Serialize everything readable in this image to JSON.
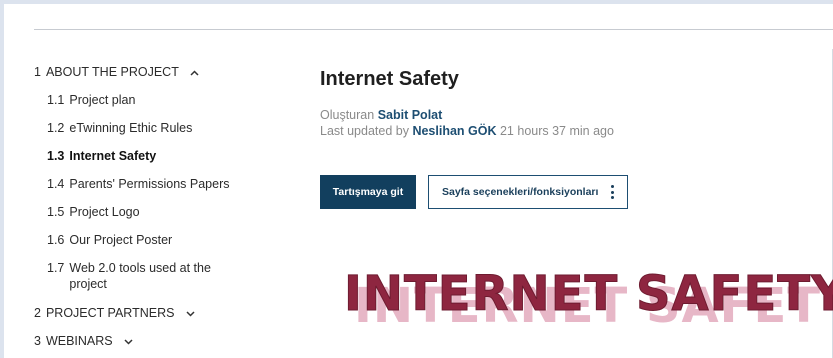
{
  "sidebar": {
    "items": [
      {
        "num": "1",
        "label": "ABOUT THE PROJECT",
        "expanded": true
      },
      {
        "num": "1.1",
        "label": "Project plan"
      },
      {
        "num": "1.2",
        "label": "eTwinning Ethic Rules"
      },
      {
        "num": "1.3",
        "label": "Internet Safety",
        "active": true
      },
      {
        "num": "1.4",
        "label": "Parents' Permissions Papers"
      },
      {
        "num": "1.5",
        "label": "Project Logo"
      },
      {
        "num": "1.6",
        "label": "Our Project Poster"
      },
      {
        "num": "1.7",
        "label": "Web 2.0 tools used at the project"
      },
      {
        "num": "2",
        "label": "PROJECT PARTNERS",
        "expanded": false
      },
      {
        "num": "3",
        "label": "WEBINARS",
        "expanded": false
      }
    ]
  },
  "page": {
    "title": "Internet Safety",
    "created_prefix": "Oluşturan",
    "created_by": "Sabit Polat",
    "updated_prefix": "Last updated by",
    "updated_by": "Neslihan GÖK",
    "updated_ago": "21 hours 37 min ago"
  },
  "actions": {
    "discuss_label": "Tartışmaya git",
    "options_label": "Sayfa seçenekleri/fonksiyonları"
  },
  "banner": {
    "text": "INTERNET SAFETY"
  },
  "colors": {
    "primary": "#123f5e",
    "link": "#1d4e72",
    "banner": "#8e2640",
    "banner_shadow": "#e7b7c7"
  }
}
